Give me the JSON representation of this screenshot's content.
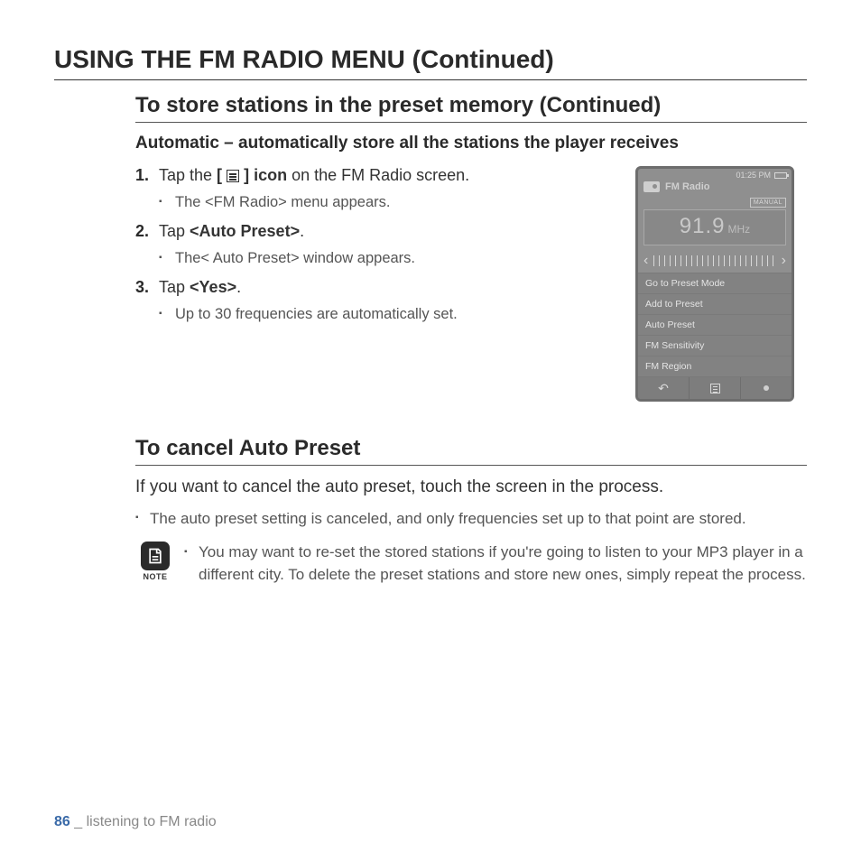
{
  "page_title": "USING THE FM RADIO MENU (Continued)",
  "section_title": "To store stations in the preset memory (Continued)",
  "auto_heading": "Automatic – automatically store all the stations the player receives",
  "steps": {
    "s1_pre": "Tap the ",
    "s1_b1": "[",
    "s1_b2": "] icon",
    "s1_post": " on the FM Radio screen.",
    "s1_sub": "The <FM Radio> menu appears.",
    "s2_pre": "Tap ",
    "s2_b": "<Auto Preset>",
    "s2_post": ".",
    "s2_sub": "The< Auto Preset> window appears.",
    "s3_pre": "Tap ",
    "s3_b": "<Yes>",
    "s3_post": ".",
    "s3_sub": "Up to 30 frequencies are automatically set."
  },
  "device": {
    "time": "01:25 PM",
    "app": "FM Radio",
    "mode": "MANUAL",
    "freq": "91.9",
    "unit": "MHz",
    "menu": [
      "Go to Preset Mode",
      "Add to Preset",
      "Auto Preset",
      "FM Sensitivity",
      "FM Region"
    ]
  },
  "cancel": {
    "title": "To cancel Auto Preset",
    "body": "If you want to cancel the auto preset, touch the screen in the process.",
    "bullet": "The auto preset setting is canceled, and only frequencies set up to that point are stored.",
    "note_label": "NOTE",
    "note_text": "You may want to re-set the stored stations if you're going to listen to your MP3 player in a different city. To delete the preset stations and store new ones, simply repeat the process."
  },
  "footer": {
    "page": "86",
    "sep": " _ ",
    "chapter": "listening to FM radio"
  }
}
